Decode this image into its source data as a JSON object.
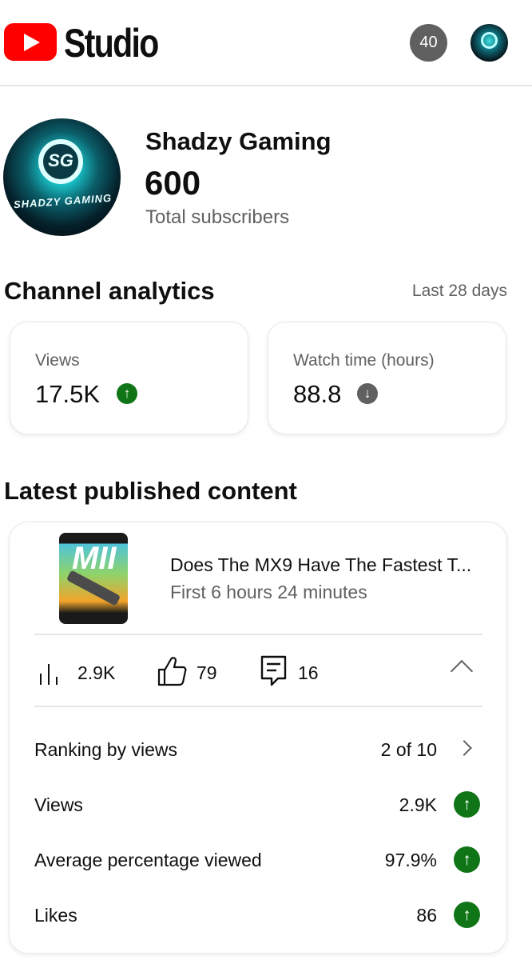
{
  "header": {
    "app_title": "Studio",
    "notification_count": "40",
    "logo_color": "#ff0000"
  },
  "channel": {
    "name": "Shadzy Gaming",
    "avatar_text": "SHADZY GAMING",
    "subscriber_count": "600",
    "subscriber_label": "Total subscribers"
  },
  "analytics": {
    "title": "Channel analytics",
    "period": "Last 28 days",
    "cards": [
      {
        "label": "Views",
        "value": "17.5K",
        "trend": "up",
        "trend_icon": "arrow-up-icon",
        "color": "#107516"
      },
      {
        "label": "Watch time (hours)",
        "value": "88.8",
        "trend": "down",
        "trend_icon": "arrow-down-icon",
        "color": "#606060"
      }
    ]
  },
  "latest": {
    "title": "Latest published content",
    "video": {
      "thumbnail_text": "MII",
      "title": "Does The MX9 Have The Fastest T...",
      "subtitle": "First 6 hours 24 minutes"
    },
    "metrics": {
      "views": "2.9K",
      "likes": "79",
      "comments": "16"
    },
    "rows": [
      {
        "label": "Ranking by views",
        "value": "2 of 10",
        "icon": "chevron-right-icon"
      },
      {
        "label": "Views",
        "value": "2.9K",
        "icon": "arrow-up-icon"
      },
      {
        "label": "Average percentage viewed",
        "value": "97.9%",
        "icon": "arrow-up-icon"
      },
      {
        "label": "Likes",
        "value": "86",
        "icon": "arrow-up-icon"
      }
    ]
  },
  "colors": {
    "trend_up": "#107516",
    "trend_neutral": "#606060",
    "text_primary": "#0f0f0f",
    "text_secondary": "#606060"
  }
}
